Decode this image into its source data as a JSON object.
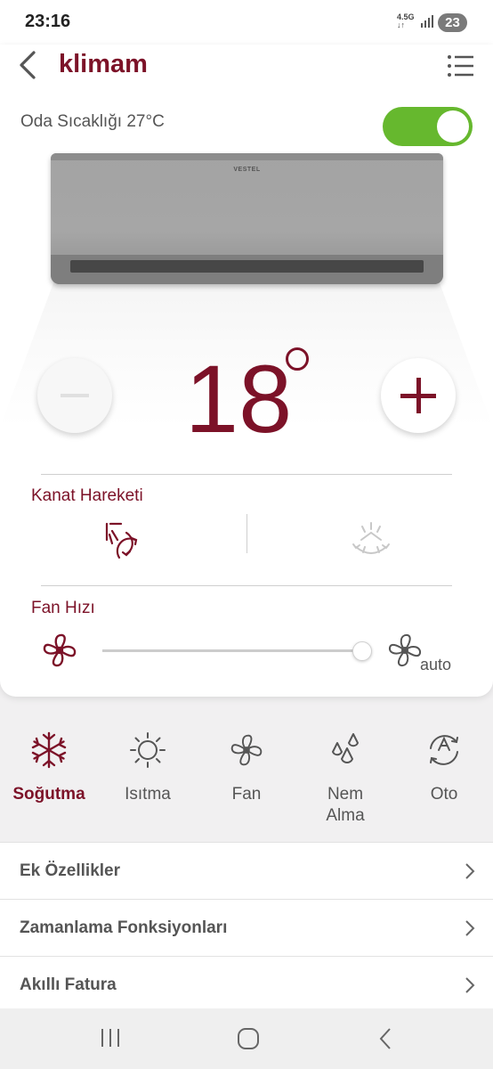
{
  "status_bar": {
    "time": "23:16",
    "network": "4.5G",
    "battery": "23"
  },
  "header": {
    "title": "klimam"
  },
  "room_temp": "Oda Sıcaklığı 27°C",
  "power_on": true,
  "device": {
    "brand": "VESTEL"
  },
  "set_temp": "18",
  "swing": {
    "label": "Kanat Hareketi"
  },
  "fan": {
    "label": "Fan Hızı",
    "level": 1.0,
    "auto_label": "auto"
  },
  "modes": [
    {
      "label": "Soğutma",
      "icon": "snowflake-icon",
      "active": true
    },
    {
      "label": "Isıtma",
      "icon": "sun-icon",
      "active": false
    },
    {
      "label": "Fan",
      "icon": "fan-icon",
      "active": false
    },
    {
      "label": "Nem Alma",
      "icon": "droplets-icon",
      "active": false
    },
    {
      "label": "Oto",
      "icon": "auto-mode-icon",
      "active": false
    }
  ],
  "menu": [
    {
      "label": "Ek Özellikler"
    },
    {
      "label": "Zamanlama Fonksiyonları"
    },
    {
      "label": "Akıllı Fatura"
    }
  ],
  "colors": {
    "accent": "#7c1228",
    "toggle_on": "#66b82e"
  }
}
